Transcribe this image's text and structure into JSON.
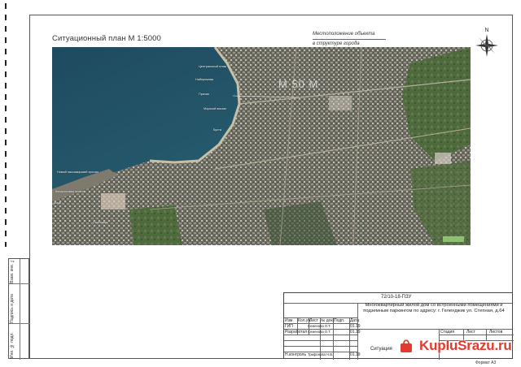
{
  "plan": {
    "title": "Ситуационный план М 1:5000",
    "location_note_1": "Местоположение объекта",
    "location_note_2": "в структуре города",
    "scale_text": "М 50 М"
  },
  "map_labels": [
    "Центральный пляж",
    "Набережная",
    "Причал",
    "Морской вокзал",
    "Новый пассажирский причал",
    "Кипарисовая аллея",
    "Гостиница",
    "Бухта",
    "Маяк"
  ],
  "compass": {
    "letter": "N"
  },
  "title_block": {
    "code": "72/10-18-ПЗУ",
    "description": "Многоквартирный жилой дом со встроенными помещениями и подземным паркингом по адресу: г. Геленджик ул. Степная, д.64",
    "header_cols": [
      "Изм.",
      "Кол.уч.",
      "Лист",
      "№ док.",
      "Подп.",
      "Дата"
    ],
    "rows": [
      {
        "role": "ГИП",
        "name": "Семенова О.Т.",
        "date": "01.19"
      },
      {
        "role": "Разработал",
        "name": "Семенова О.Т.",
        "date": "01.19"
      },
      {
        "role": "Н.контроль",
        "name": "Трифонова Н.В.",
        "date": "01.19"
      }
    ],
    "stage_headers": [
      "Стадия",
      "Лист",
      "Листов"
    ],
    "sheet_name": "Ситуация",
    "format": "Формат А3"
  },
  "left_stamp": [
    "Инв. № подл.",
    "Подпись и дата",
    "Взам. инв. №"
  ],
  "watermark": {
    "text": "KupluSrazu.ru"
  },
  "colors": {
    "sea": "#2a4f5e",
    "land": "#5a6a4e",
    "watermark": "#e23a2e"
  }
}
